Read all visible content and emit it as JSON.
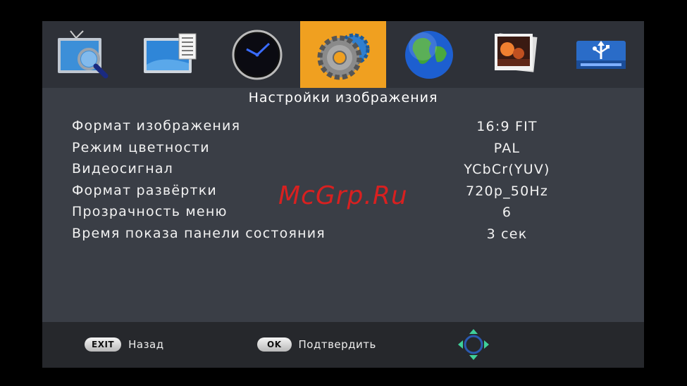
{
  "menu": {
    "icons": [
      {
        "name": "tv-search-icon"
      },
      {
        "name": "tv-guide-icon"
      },
      {
        "name": "clock-icon"
      },
      {
        "name": "settings-gears-icon"
      },
      {
        "name": "globe-icon"
      },
      {
        "name": "photos-icon"
      },
      {
        "name": "usb-drive-icon"
      }
    ],
    "active_index": 3,
    "active_color": "#f0a020"
  },
  "title": "Настройки изображения",
  "settings": [
    {
      "label": "Формат изображения",
      "value": "16:9 FIT"
    },
    {
      "label": "Режим цветности",
      "value": "PAL"
    },
    {
      "label": "Видеосигнал",
      "value": "YCbCr(YUV)"
    },
    {
      "label": "Формат развёртки",
      "value": "720p_50Hz"
    },
    {
      "label": "Прозрачность меню",
      "value": "6"
    },
    {
      "label": "Время показа панели состояния",
      "value": "3 сек"
    }
  ],
  "watermark": "McGrp.Ru",
  "footer": {
    "exit_key": "EXIT",
    "exit_label": "Назад",
    "ok_key": "OK",
    "ok_label": "Подтвердить"
  }
}
